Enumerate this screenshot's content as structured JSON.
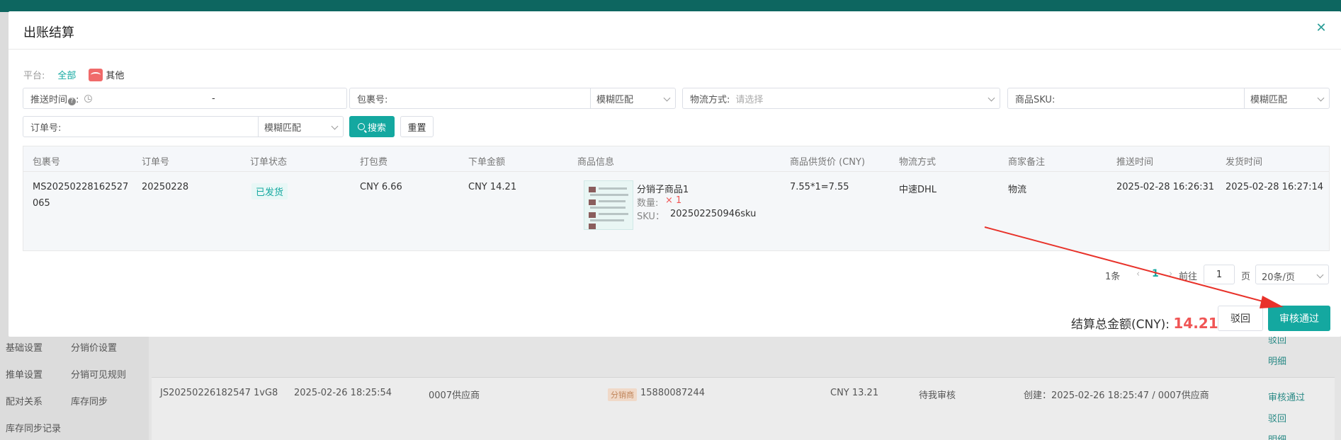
{
  "background": {
    "sidebar_items": [
      "基础设置",
      "分销价设置",
      "推单设置",
      "分销可见规则",
      "配对关系",
      "库存同步",
      "库存同步记录"
    ],
    "row": {
      "id": "JS20250226182547 1vG8",
      "time": "2025-02-26 18:25:54",
      "supplier": "0007供应商",
      "role_tag": "分销商",
      "phone": "15880087244",
      "amount": "CNY 13.21",
      "status": "待我审核",
      "created": "创建：2025-02-26 18:25:47 / 0007供应商"
    },
    "links": [
      "驳回",
      "明细",
      "审核通过",
      "驳回",
      "明细"
    ]
  },
  "dialog": {
    "title": "出账结算",
    "close_icon": "close-icon",
    "platform": {
      "label": "平台:",
      "all": "全部",
      "other": "其他"
    },
    "filters": {
      "push_time_label": "推送时间",
      "push_time_suffix": ":",
      "range_separator": "-",
      "package_label": "包裹号:",
      "package_match": "模糊匹配",
      "logistics_label": "物流方式:",
      "logistics_placeholder": "请选择",
      "sku_label": "商品SKU:",
      "sku_match": "模糊匹配",
      "order_label": "订单号:",
      "order_match": "模糊匹配",
      "search": "搜索",
      "reset": "重置"
    },
    "table": {
      "headers": [
        "包裹号",
        "订单号",
        "订单状态",
        "打包费",
        "下单金额",
        "商品信息",
        "商品供货价 (CNY)",
        "物流方式",
        "商家备注",
        "推送时间",
        "发货时间"
      ],
      "row": {
        "package_line1": "MS20250228162527",
        "package_line2": "065",
        "order": "20250228",
        "status": "已发货",
        "packing_fee": "CNY 6.66",
        "order_amount": "CNY 14.21",
        "product_name": "分销子商品1",
        "qty_label": "数量:",
        "qty_value": "× 1",
        "sku_label": "SKU：",
        "sku_value": "202502250946sku",
        "supply_price": "7.55*1=7.55",
        "logistics": "中速DHL",
        "note": "物流",
        "push_time": "2025-02-28 16:26:31",
        "ship_time": "2025-02-28 16:27:14"
      }
    },
    "pagination": {
      "total": "1条",
      "current": "1",
      "goto_label": "前往",
      "page_input": "1",
      "page_unit": "页",
      "page_size": "20条/页"
    },
    "footer": {
      "total_label": "结算总金额(CNY):",
      "total_amount": "14.21",
      "reject": "驳回",
      "approve": "审核通过"
    }
  }
}
